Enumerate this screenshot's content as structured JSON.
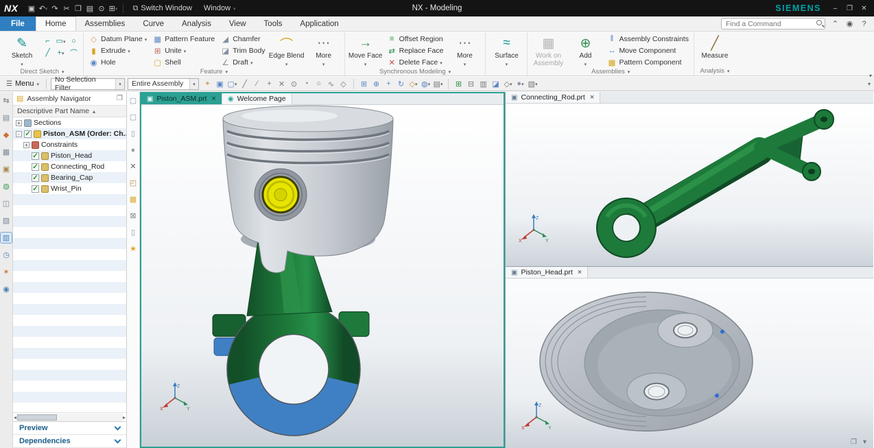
{
  "colors": {
    "accent_teal": "#2ba093",
    "file_tab_blue": "#2f7fc1",
    "siemens_teal": "#00a2a8",
    "rod_green": "#1d7a3a",
    "bearing_cap_blue": "#3f80c4",
    "wrist_pin_yellow": "#e8e400",
    "titlebar_bg": "#141414",
    "stripe_blue": "#eaf1f8"
  },
  "triad": {
    "x": "X",
    "y": "Y",
    "z": "Z"
  },
  "titlebar": {
    "logo": "NX",
    "title": "NX - Modeling",
    "brand": "SIEMENS",
    "switch_window": "Switch Window",
    "window_menu": "Window",
    "icons": [
      {
        "name": "save-icon",
        "glyph": "▣"
      },
      {
        "name": "undo-icon",
        "glyph": "↶",
        "dropdown": true
      },
      {
        "name": "redo-icon",
        "glyph": "↷"
      },
      {
        "name": "cut-icon",
        "glyph": "✂"
      },
      {
        "name": "copy-icon",
        "glyph": "❐"
      },
      {
        "name": "paste-icon",
        "glyph": "▤"
      },
      {
        "name": "capture-icon",
        "glyph": "⊙"
      },
      {
        "name": "window-layout-icon",
        "glyph": "⊞",
        "dropdown": true
      }
    ],
    "window_controls": [
      {
        "name": "minimize-window-icon",
        "glyph": "–"
      },
      {
        "name": "restore-window-icon",
        "glyph": "❐"
      },
      {
        "name": "close-window-icon",
        "glyph": "✕"
      }
    ]
  },
  "ribbon": {
    "tabs": [
      {
        "label": "File",
        "file": true
      },
      {
        "label": "Home",
        "active": true
      },
      {
        "label": "Assemblies"
      },
      {
        "label": "Curve"
      },
      {
        "label": "Analysis"
      },
      {
        "label": "View"
      },
      {
        "label": "Tools"
      },
      {
        "label": "Application"
      }
    ],
    "search_placeholder": "Find a Command",
    "window_icons": [
      {
        "name": "minimize-ribbon-icon",
        "glyph": "⌃",
        "color": "#555"
      },
      {
        "name": "user-profile-icon",
        "glyph": "◉",
        "color": "#555"
      },
      {
        "name": "help-icon",
        "glyph": "?",
        "color": "#555"
      }
    ],
    "direct_sketch": {
      "label": "Direct Sketch",
      "sketch": "Sketch",
      "tools": [
        {
          "name": "profile-icon",
          "glyph": "⌐",
          "color": "#0e8f8f"
        },
        {
          "name": "rectangle-icon",
          "glyph": "▭",
          "color": "#0e8f8f",
          "dropdown": true
        },
        {
          "name": "circle-icon",
          "glyph": "○",
          "color": "#0e8f8f"
        },
        {
          "name": "line-icon",
          "glyph": "╱",
          "color": "#0e8f8f"
        },
        {
          "name": "point-icon",
          "glyph": "+",
          "color": "#0e8f8f",
          "dropdown": true
        },
        {
          "name": "arc-icon",
          "glyph": "⌒",
          "color": "#0e8f8f"
        }
      ]
    },
    "feature": {
      "label": "Feature",
      "datum_plane": "Datum Plane",
      "extrude": "Extrude",
      "hole": "Hole",
      "pattern_feature": "Pattern Feature",
      "unite": "Unite",
      "shell": "Shell",
      "chamfer": "Chamfer",
      "trim_body": "Trim Body",
      "draft": "Draft",
      "edge_blend": "Edge Blend",
      "more": "More"
    },
    "sync": {
      "label": "Synchronous Modeling",
      "move_face": "Move Face",
      "offset_region": "Offset Region",
      "replace_face": "Replace Face",
      "delete_face": "Delete Face",
      "more": "More"
    },
    "surface": {
      "surface": "Surface"
    },
    "assemblies": {
      "label": "Assemblies",
      "work_on_assembly": "Work on Assembly",
      "add": "Add",
      "assembly_constraints": "Assembly Constraints",
      "move_component": "Move Component",
      "pattern_component": "Pattern Component"
    },
    "analysis": {
      "label": "Analysis",
      "measure": "Measure"
    }
  },
  "selection_bar": {
    "menu": "Menu",
    "filter_value": "No Selection Filter",
    "scope_value": "Entire Assembly",
    "snap_icons": [
      {
        "name": "snap-point-icon",
        "glyph": "⌖",
        "color": "#b5822a"
      },
      {
        "name": "select-face-icon",
        "glyph": "▣",
        "color": "#5b87c5"
      },
      {
        "name": "filter-region-icon",
        "glyph": "▢",
        "color": "#5b87c5",
        "dropdown": true
      },
      {
        "name": "end-point-icon",
        "glyph": "╱",
        "color": "#777"
      },
      {
        "name": "mid-point-icon",
        "glyph": "∕",
        "color": "#777"
      },
      {
        "name": "control-point-icon",
        "glyph": "+",
        "color": "#777"
      },
      {
        "name": "intersection-point-icon",
        "glyph": "✕",
        "color": "#777"
      },
      {
        "name": "arc-center-icon",
        "glyph": "⊙",
        "color": "#777"
      },
      {
        "name": "quadrant-point-icon",
        "glyph": "◔",
        "color": "#777"
      },
      {
        "name": "existing-point-icon",
        "glyph": "○",
        "color": "#777"
      },
      {
        "name": "point-on-curve-icon",
        "glyph": "∿",
        "color": "#777"
      },
      {
        "name": "point-on-surface-icon",
        "glyph": "◇",
        "color": "#777"
      }
    ],
    "view_icons": [
      {
        "name": "fit-window-icon",
        "glyph": "⊞",
        "color": "#5b87c5"
      },
      {
        "name": "zoom-in-icon",
        "glyph": "⊕",
        "color": "#5b87c5"
      },
      {
        "name": "pan-view-icon",
        "glyph": "+",
        "color": "#5b87c5"
      },
      {
        "name": "rotate-view-icon",
        "glyph": "↻",
        "color": "#5b87c5"
      },
      {
        "name": "orient-view-icon",
        "glyph": "◇",
        "color": "#d98b2b",
        "dropdown": true
      },
      {
        "name": "rendering-style-icon",
        "glyph": "◍",
        "color": "#5b87c5",
        "dropdown": true
      },
      {
        "name": "work-layer-icon",
        "glyph": "▤",
        "color": "#777",
        "dropdown": true
      }
    ],
    "tool_icons": [
      {
        "name": "show-hide-icon",
        "glyph": "⊞",
        "color": "#2f8f4f"
      },
      {
        "name": "immediate-hide-icon",
        "glyph": "⊟",
        "color": "#777"
      },
      {
        "name": "layer-settings-icon",
        "glyph": "▥",
        "color": "#777"
      },
      {
        "name": "clip-section-icon",
        "glyph": "◪",
        "color": "#5b87c5"
      },
      {
        "name": "wireframe-style-icon",
        "glyph": "◇",
        "color": "#777",
        "dropdown": true
      },
      {
        "name": "shaded-style-icon",
        "glyph": "●",
        "color": "#8a99a8",
        "dropdown": true
      },
      {
        "name": "background-icon",
        "glyph": "▧",
        "color": "#777",
        "dropdown": true
      }
    ]
  },
  "resource_bar": {
    "icons": [
      {
        "name": "resource-bar-options-icon",
        "glyph": "⇆",
        "color": "#777"
      },
      {
        "name": "assembly-navigator-icon",
        "glyph": "▤",
        "color": "#7b8a9a"
      },
      {
        "name": "constraint-navigator-icon",
        "glyph": "◆",
        "color": "#d07030"
      },
      {
        "name": "part-navigator-icon",
        "glyph": "▦",
        "color": "#7b8a9a"
      },
      {
        "name": "reuse-library-icon",
        "glyph": "▣",
        "color": "#a88a55"
      },
      {
        "name": "hd3d-tools-icon",
        "glyph": "◍",
        "color": "#3a9d5c"
      },
      {
        "name": "internet-browser-icon",
        "glyph": "◫",
        "color": "#7b8a9a"
      },
      {
        "name": "visual-reports-icon",
        "glyph": "▧",
        "color": "#7b8a9a"
      },
      {
        "name": "roles-icon",
        "glyph": "▥",
        "color": "#4a7fb5",
        "sel": true
      },
      {
        "name": "history-icon",
        "glyph": "◷",
        "color": "#4a7fb5"
      },
      {
        "name": "manufacturing-wizards-icon",
        "glyph": "✶",
        "color": "#d07030"
      },
      {
        "name": "system-scene-icon",
        "glyph": "◉",
        "color": "#4a7fb5"
      }
    ]
  },
  "navigator": {
    "title": "Assembly Navigator",
    "column_header": "Descriptive Part Name",
    "rows": [
      {
        "label": "Sections",
        "expander": "+",
        "icon": "sections-icon",
        "indent": 0,
        "name": "tree-item-sections"
      },
      {
        "label": "Piston_ASM (Order: Ch...",
        "expander": "-",
        "checked": true,
        "icon": "assembly-icon",
        "indent": 0,
        "bold": true,
        "name": "tree-item-piston-asm"
      },
      {
        "label": "Constraints",
        "expander": "+",
        "icon": "constraints-icon",
        "indent": 1,
        "name": "tree-item-constraints"
      },
      {
        "label": "Piston_Head",
        "checked": true,
        "icon": "part-icon",
        "indent": 1,
        "name": "tree-item-piston-head"
      },
      {
        "label": "Connecting_Rod",
        "checked": true,
        "icon": "part-icon",
        "indent": 1,
        "name": "tree-item-connecting-rod"
      },
      {
        "label": "Bearing_Cap",
        "checked": true,
        "icon": "part-icon",
        "indent": 1,
        "name": "tree-item-bearing-cap"
      },
      {
        "label": "Wrist_Pin",
        "checked": true,
        "icon": "part-icon",
        "indent": 1,
        "name": "tree-item-wrist-pin"
      }
    ],
    "empty_rows": 22,
    "footer": {
      "preview": "Preview",
      "dependencies": "Dependencies"
    }
  },
  "tool_strip": {
    "icons": [
      {
        "name": "blank-page-icon",
        "glyph": "▢",
        "color": "#8a99a8"
      },
      {
        "name": "blank-page-icon-2",
        "glyph": "▢",
        "color": "#8a99a8"
      },
      {
        "name": "datum-cylinder-icon",
        "glyph": "▯",
        "color": "#8a99a8"
      },
      {
        "name": "sphere-icon",
        "glyph": "●",
        "color": "#9aa1a8"
      },
      {
        "name": "close-x-icon",
        "glyph": "✕",
        "color": "#666"
      },
      {
        "name": "open-folder-icon",
        "glyph": "◰",
        "color": "#b89045"
      },
      {
        "name": "yellow-block-icon",
        "glyph": "▩",
        "color": "#d9b13b"
      },
      {
        "name": "delete-box-icon",
        "glyph": "⊠",
        "color": "#888"
      },
      {
        "name": "cylinder-icon",
        "glyph": "▯",
        "color": "#8a99a8"
      },
      {
        "name": "favorites-star-icon",
        "glyph": "★",
        "color": "#e0a828"
      }
    ]
  },
  "viewports": {
    "main": {
      "tabs": [
        {
          "label": "Piston_ASM.prt",
          "icon": "part",
          "close": true,
          "active": true
        },
        {
          "label": "Welcome Page",
          "icon": "welcome"
        }
      ]
    },
    "top_right": {
      "tabs": [
        {
          "label": "Connecting_Rod.prt",
          "icon": "part",
          "close": true
        }
      ]
    },
    "bottom_right": {
      "tabs": [
        {
          "label": "Piston_Head.prt",
          "icon": "part",
          "close": true
        }
      ]
    }
  },
  "corner": {
    "icons": [
      {
        "name": "restore-windows-icon",
        "glyph": "❐",
        "color": "#667788"
      },
      {
        "name": "window-list-icon",
        "glyph": "▾",
        "color": "#667788"
      }
    ]
  }
}
